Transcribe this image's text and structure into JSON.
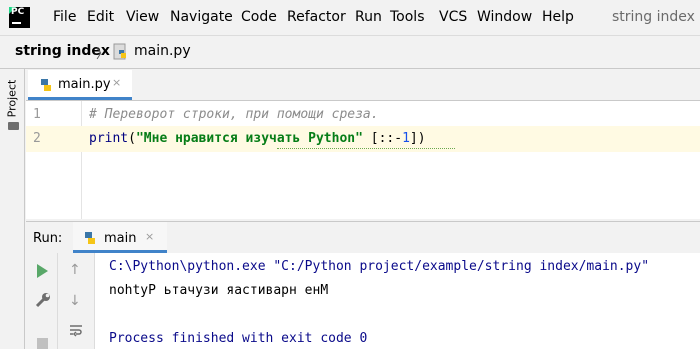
{
  "menubar": {
    "items": [
      "File",
      "Edit",
      "View",
      "Navigate",
      "Code",
      "Refactor",
      "Run",
      "Tools",
      "VCS",
      "Window",
      "Help"
    ],
    "window_title": "string index -"
  },
  "navbar": {
    "project": "string index",
    "separator": "〉",
    "file": "main.py"
  },
  "sidebar": {
    "project_tab": "Project"
  },
  "editor": {
    "tab_label": "main.py",
    "tab_close": "×",
    "line_numbers": [
      "1",
      "2"
    ],
    "line1": "# Переворот строки, при помощи среза.",
    "line2": {
      "func": "print",
      "open": "(",
      "string": "\"Мне нравится изучать Python\"",
      "slice_open": " [::-",
      "slice_num": "1",
      "slice_close": "])"
    }
  },
  "run_panel": {
    "label": "Run:",
    "tab_label": "main",
    "tab_close": "×",
    "output": [
      "C:\\Python\\python.exe \"C:/Python project/example/string index/main.py\"",
      "nohtyP ьтачузи яастиварн енМ",
      "Process finished with exit code 0"
    ],
    "icons": [
      "play-icon",
      "wrench-icon",
      "stop-icon",
      "up-arrow-icon",
      "down-arrow-icon",
      "soft-wrap-icon"
    ]
  },
  "colors": {
    "accent": "#4083c9",
    "string": "#067d17",
    "keyword": "#000080",
    "number": "#1750eb",
    "comment": "#8c8c8c",
    "line_highlight": "#fffae3",
    "run_green": "#59a869"
  }
}
